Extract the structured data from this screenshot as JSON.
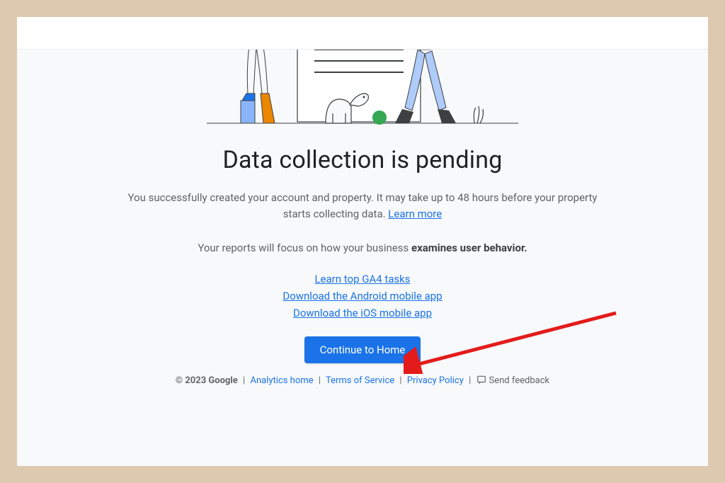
{
  "title": "Data collection is pending",
  "description": {
    "text_before": "You successfully created your account and property. It may take up to 48 hours before your property starts collecting data. ",
    "learn_more": "Learn more"
  },
  "focus": {
    "prefix": "Your reports will focus on how your business ",
    "bold": "examines user behavior."
  },
  "links": {
    "ga4_tasks": "Learn top GA4 tasks",
    "android_app": "Download the Android mobile app",
    "ios_app": "Download the iOS mobile app"
  },
  "cta_label": "Continue to Home",
  "footer": {
    "copyright": "© 2023 Google",
    "analytics_home": "Analytics home",
    "terms": "Terms of Service",
    "privacy": "Privacy Policy",
    "feedback": "Send feedback"
  }
}
